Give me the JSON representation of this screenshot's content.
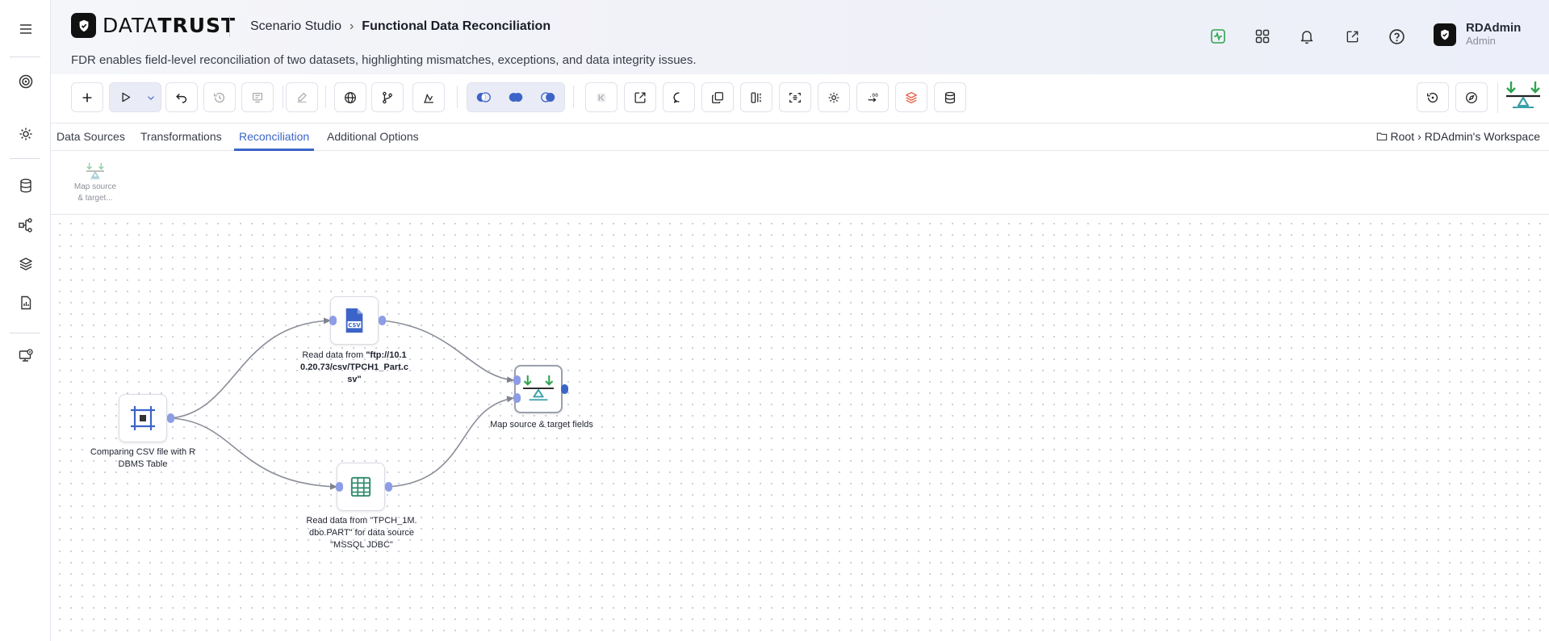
{
  "brand": {
    "name_prefix": "DATA",
    "name_suffix": "TRUST"
  },
  "header": {
    "breadcrumb_parent": "Scenario Studio",
    "breadcrumb_sep": "›",
    "breadcrumb_current": "Functional Data Reconciliation",
    "subtitle": "FDR enables field-level reconciliation of two datasets, highlighting mismatches, exceptions, and data integrity issues."
  },
  "header_icons": [
    "activity-icon",
    "grid-icon",
    "bell-icon",
    "external-link-icon",
    "help-icon"
  ],
  "user": {
    "name": "RDAdmin",
    "role": "Admin"
  },
  "sidebar": {
    "items": [
      "menu-icon",
      "target-icon",
      "settings-icon",
      "database-icon",
      "nodes-icon",
      "layers-icon",
      "report-icon",
      "monitor-icon"
    ]
  },
  "tabs": [
    {
      "label": "Data Sources"
    },
    {
      "label": "Transformations"
    },
    {
      "label": "Reconciliation"
    },
    {
      "label": "Additional Options"
    }
  ],
  "active_tab": "Reconciliation",
  "workspace": {
    "root": "Root",
    "sep": "›",
    "name": "RDAdmin's Workspace"
  },
  "palette": {
    "item_label_1": "Map source",
    "item_label_2": "& target..."
  },
  "nodes": {
    "source": {
      "label": "Comparing CSV file with RDBMS Table",
      "label_l1": "Comparing CSV file with R",
      "label_l2": "DBMS Table"
    },
    "csv": {
      "label_prefix": "Read data from ",
      "label_l1_b": "\"ftp://10.1",
      "label_l2_b": "0.20.73/csv/TPCH1_Part.c",
      "label_l3_b": "sv\""
    },
    "table": {
      "label_l1": "Read data from \"TPCH_1M.",
      "label_l2": "dbo.PART\" for data source",
      "label_l3": "\"MSSQL JDBC\""
    },
    "map": {
      "label": "Map source & target fields"
    }
  },
  "colors": {
    "accent": "#3c64c8",
    "port": "#8c9ce6",
    "green": "#2ea44f",
    "teal": "#3aa0a8"
  }
}
